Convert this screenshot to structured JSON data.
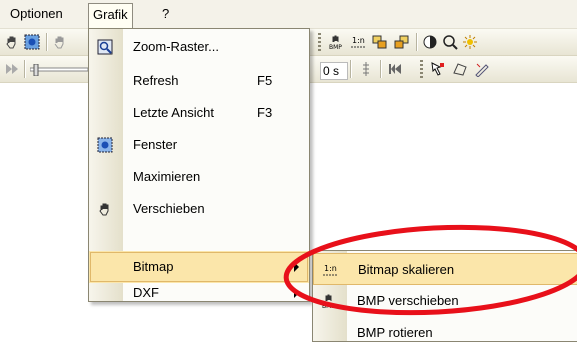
{
  "menubar": {
    "items": [
      {
        "label": "Optionen"
      },
      {
        "label": "Grafik"
      },
      {
        "label": "?"
      }
    ]
  },
  "toolbar": {
    "time_value": "0 s"
  },
  "grafik_menu": {
    "items": [
      {
        "label": "Zoom-Raster...",
        "icon": "zoom-grid-icon",
        "shortcut": ""
      },
      {
        "label": "Refresh",
        "icon": "",
        "shortcut": "F5"
      },
      {
        "label": "Letzte Ansicht",
        "icon": "",
        "shortcut": "F3"
      },
      {
        "label": "Fenster",
        "icon": "window-zoom-icon",
        "shortcut": ""
      },
      {
        "label": "Maximieren",
        "icon": "",
        "shortcut": ""
      },
      {
        "label": "Verschieben",
        "icon": "hand-pan-icon",
        "shortcut": ""
      },
      {
        "label": "Bitmap",
        "icon": "",
        "shortcut": "",
        "submenu": true,
        "highlighted": true
      },
      {
        "label": "DXF",
        "icon": "",
        "shortcut": "",
        "submenu": true
      }
    ]
  },
  "bitmap_submenu": {
    "items": [
      {
        "label": "Bitmap skalieren",
        "icon": "scale-1to1-icon",
        "highlighted": true
      },
      {
        "label": "BMP verschieben",
        "icon": "bmp-move-icon"
      },
      {
        "label": "BMP rotieren",
        "icon": ""
      }
    ]
  },
  "colors": {
    "highlight": "#fbe6aa",
    "highlight_border": "#e0b86a",
    "annotation_ring": "#e8101a",
    "menubar_bg": "#f4f2e9"
  }
}
